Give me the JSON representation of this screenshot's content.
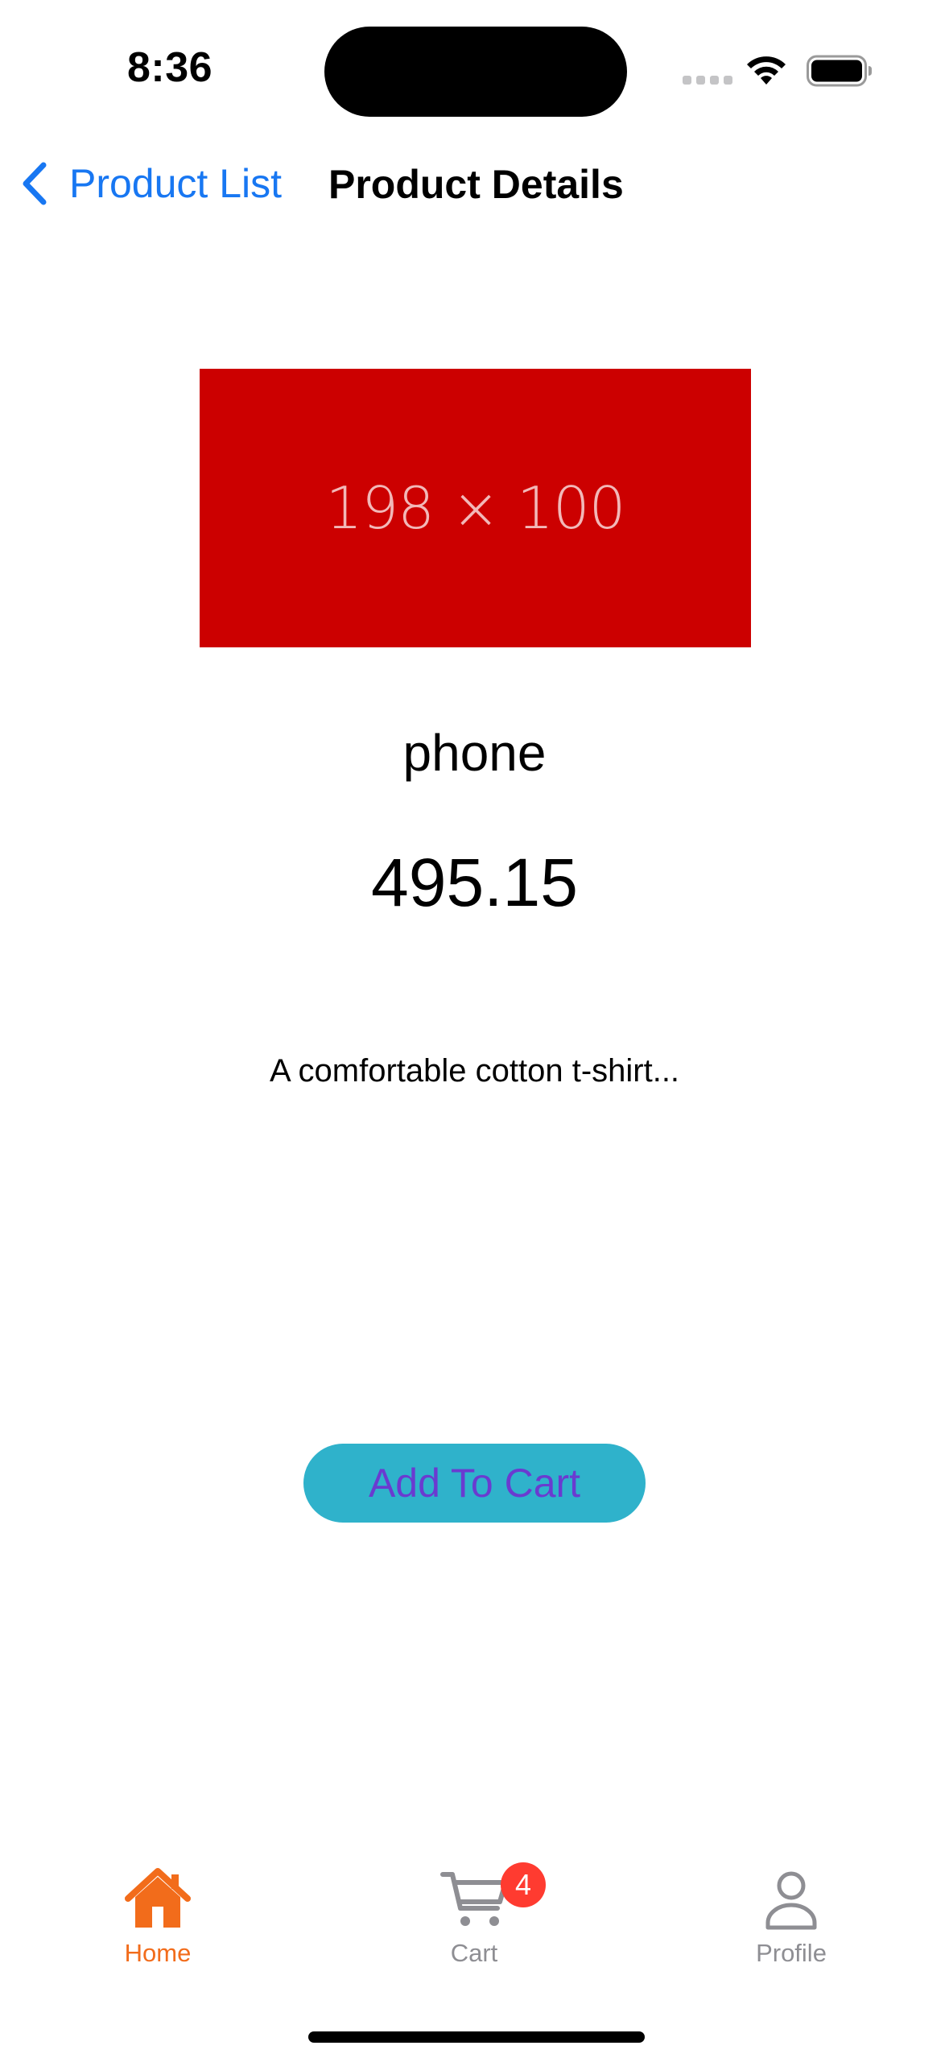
{
  "status_bar": {
    "time": "8:36"
  },
  "nav": {
    "back_label": "Product List",
    "title": "Product Details"
  },
  "product": {
    "image_placeholder": "198 × 100",
    "name": "phone",
    "price": "495.15",
    "description": "A comfortable cotton t-shirt...",
    "add_to_cart_label": "Add To Cart"
  },
  "tab_bar": {
    "tabs": [
      {
        "label": "Home",
        "icon": "home-icon",
        "active": true
      },
      {
        "label": "Cart",
        "icon": "cart-icon",
        "badge": "4"
      },
      {
        "label": "Profile",
        "icon": "profile-icon"
      }
    ]
  },
  "colors": {
    "accent": "#1877f2",
    "active_tab": "#f26c1b",
    "inactive_tab": "#8e8e93",
    "image_bg": "#cc0000",
    "button_bg": "#2fb2cb",
    "button_text": "#6a3bd0",
    "badge": "#ff3b30"
  }
}
